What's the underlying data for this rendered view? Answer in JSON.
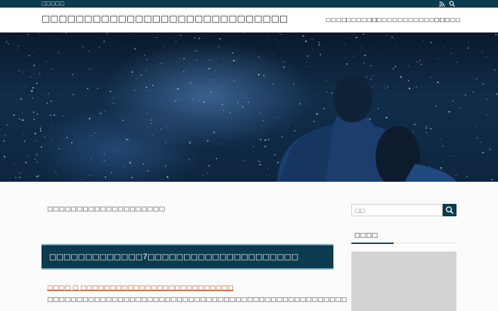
{
  "topbar": {
    "tagline": "□□□□□",
    "rss_icon": "rss-icon",
    "search_icon": "search-icon"
  },
  "header": {
    "site_title": "□□□□□□□□□□□□□□□□□□□□□□□□□□□□□",
    "nav": [
      "□□□□",
      "□□□□□□",
      "□□□□□",
      "□□□□□□□□□□",
      "□□□□□"
    ]
  },
  "hero": {
    "image": "starry-night-couple"
  },
  "breadcrumb": "□□□□□□□□□□□□□□□□□□□□",
  "post": {
    "title": "□□□□□□□□□□□□□7□□□□□□□□□□□□□□□□□□□□□",
    "meta": "□□□□ □ □□□□□□□□□□□□□□□□□□□□□□□□□□",
    "excerpt": "□□□□□□□□□□□□□□□□□□□□□□□□□□□□□□□□□□□□□□□□□□□□□□□□□□□"
  },
  "sidebar": {
    "search_placeholder": "□□",
    "search_button_icon": "search-icon",
    "widget_title": "□□□□"
  },
  "colors": {
    "primary": "#0c3a4e",
    "accent_link": "#c2440f",
    "background": "#fbfbfb"
  }
}
